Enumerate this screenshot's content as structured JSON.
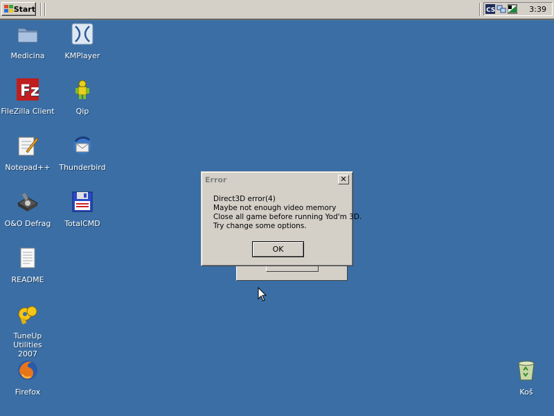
{
  "taskbar": {
    "start_label": "Start",
    "tray_icons": [
      "cs-icon",
      "network-icon",
      "display-icon"
    ],
    "tray_cs_label": "CS",
    "clock": "3:39"
  },
  "desktop": {
    "icons": [
      {
        "label": "Medicina",
        "icon": "folder-icon"
      },
      {
        "label": "KMPlayer",
        "icon": "kmplayer-icon"
      },
      {
        "label": "FileZilla Client",
        "icon": "filezilla-icon"
      },
      {
        "label": "Qip",
        "icon": "qip-icon"
      },
      {
        "label": "Notepad++",
        "icon": "notepad-plus-plus-icon"
      },
      {
        "label": "Thunderbird",
        "icon": "thunderbird-icon"
      },
      {
        "label": "O&O Defrag",
        "icon": "defrag-icon"
      },
      {
        "label": "TotalCMD",
        "icon": "floppy-disk-icon"
      },
      {
        "label": "README",
        "icon": "text-document-icon"
      },
      {
        "label": "TuneUp Utilities 2007",
        "line1": "TuneUp Utilities",
        "line2": "2007",
        "icon": "tuneup-icon"
      },
      {
        "label": "Firefox",
        "icon": "firefox-icon"
      },
      {
        "label": "Koš",
        "icon": "recycle-bin-icon"
      }
    ]
  },
  "dialog": {
    "title": "Error",
    "close_glyph": "✕",
    "message_lines": [
      "Direct3D error(4)",
      "Maybe not enough video memory",
      "Close all game before running Yod'm 3D.",
      "Try change some options."
    ],
    "ok_label": "OK"
  }
}
